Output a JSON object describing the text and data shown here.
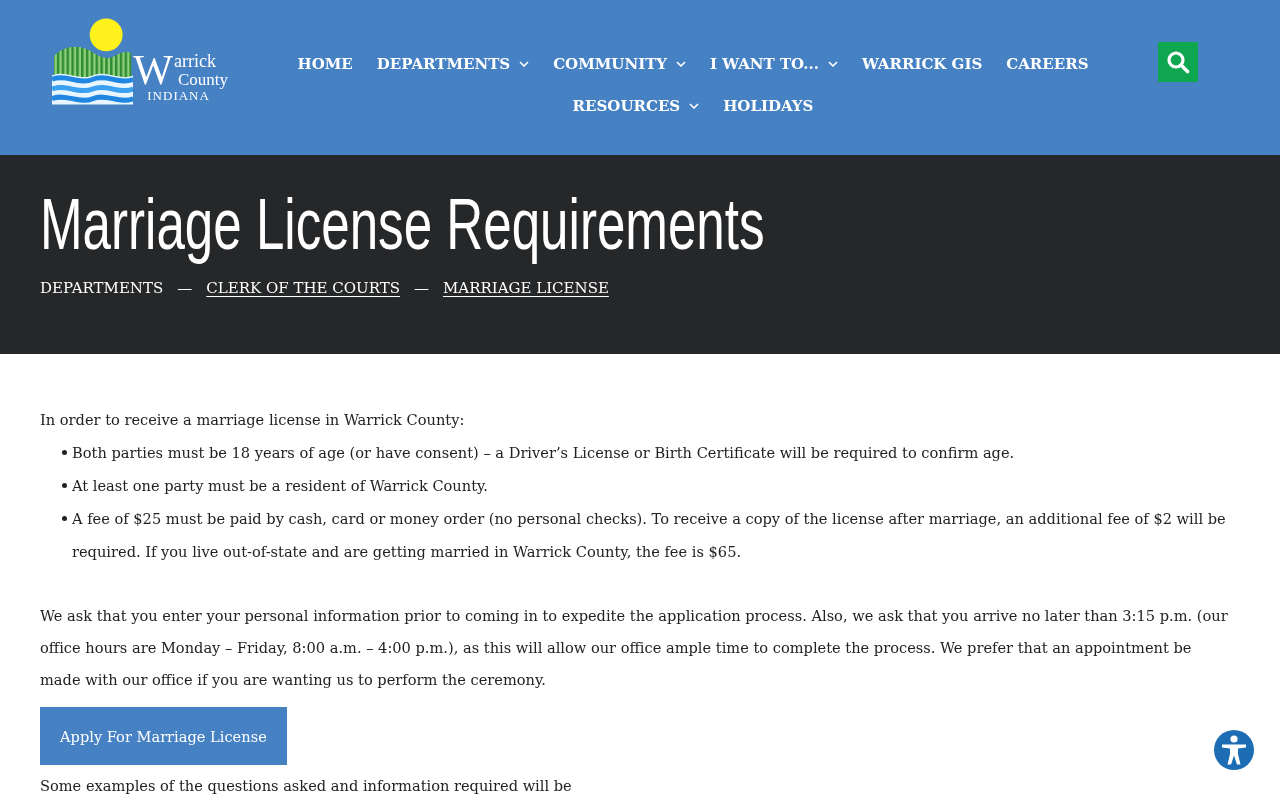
{
  "header": {
    "logo": {
      "initial": "W",
      "lines": [
        "arrick",
        "County",
        "INDIANA"
      ]
    },
    "nav": [
      {
        "label": "HOME",
        "kind": "link"
      },
      {
        "label": "DEPARTMENTS",
        "kind": "dropdown"
      },
      {
        "label": "COMMUNITY",
        "kind": "dropdown"
      },
      {
        "label": "I WANT TO...",
        "kind": "dropdown"
      },
      {
        "label": "WARRICK GIS",
        "kind": "link"
      },
      {
        "label": "CAREERS",
        "kind": "link"
      },
      {
        "label": "RESOURCES",
        "kind": "dropdown"
      },
      {
        "label": "HOLIDAYS",
        "kind": "link"
      }
    ]
  },
  "page_title": {
    "title": "Marriage License Requirements",
    "breadcrumbs": [
      {
        "label": "DEPARTMENTS",
        "kind": "text"
      },
      {
        "label": "—",
        "kind": "separator"
      },
      {
        "label": "CLERK OF THE COURTS",
        "kind": "link"
      },
      {
        "label": "—",
        "kind": "separator"
      },
      {
        "label": "MARRIAGE LICENSE",
        "kind": "link"
      }
    ]
  },
  "content": {
    "intro": "In order to receive a marriage license in Warrick County:",
    "requirements": [
      "Both parties must be 18 years of age (or have consent) – a Driver’s License or Birth Certificate will be required to confirm age.",
      "At least one party must be a resident of Warrick County.",
      "A fee of $25 must be paid by cash, card or money order (no personal checks). To receive a copy of the license after marriage, an additional fee of $2 will be required. If you live out-of-state and are getting married in Warrick County, the fee is $65."
    ],
    "paragraph": "We ask that you enter your personal information prior to coming in to expedite the application process. Also, we ask that you arrive no later than 3:15 p.m. (our office hours are Monday – Friday, 8:00 a.m. – 4:00 p.m.), as this will allow our office ample time to complete the process. We prefer that an appointment be made with our office if you are wanting us to perform the ceremony.",
    "apply_button": "Apply For Marriage License",
    "next_paragraph": "Some examples of the questions asked and information required will be"
  }
}
